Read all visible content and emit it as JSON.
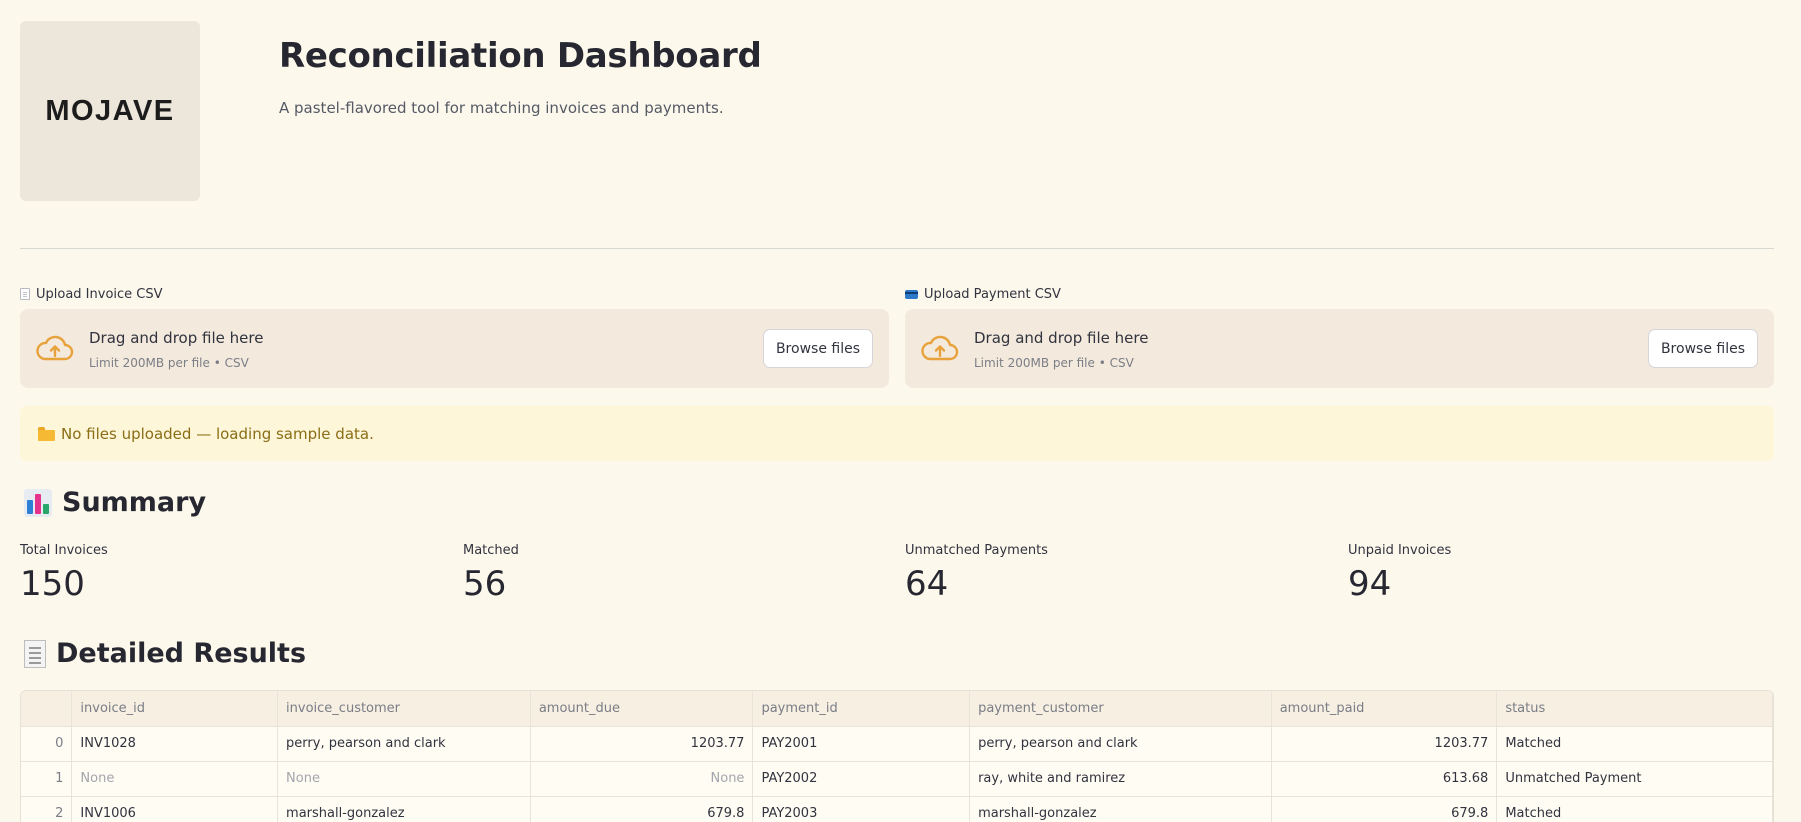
{
  "header": {
    "logo_text": "MOJAVE",
    "title": "Reconciliation Dashboard",
    "subtitle": "A pastel-flavored tool for matching invoices and payments."
  },
  "uploaders": [
    {
      "label": "Upload Invoice CSV",
      "icon": "page-icon",
      "drop_text": "Drag and drop file here",
      "limit_text": "Limit 200MB per file • CSV",
      "button_label": "Browse files"
    },
    {
      "label": "Upload Payment CSV",
      "icon": "credit-card-icon",
      "drop_text": "Drag and drop file here",
      "limit_text": "Limit 200MB per file • CSV",
      "button_label": "Browse files"
    }
  ],
  "alert": {
    "icon": "folder-icon",
    "text": "No files uploaded — loading sample data."
  },
  "summary": {
    "heading": "Summary",
    "icon": "bar-chart-icon",
    "metrics": [
      {
        "label": "Total Invoices",
        "value": "150"
      },
      {
        "label": "Matched",
        "value": "56"
      },
      {
        "label": "Unmatched Payments",
        "value": "64"
      },
      {
        "label": "Unpaid Invoices",
        "value": "94"
      }
    ]
  },
  "details": {
    "heading": "Detailed Results",
    "icon": "receipt-icon",
    "columns": [
      "",
      "invoice_id",
      "invoice_customer",
      "amount_due",
      "payment_id",
      "payment_customer",
      "amount_paid",
      "status"
    ],
    "rows": [
      [
        "0",
        "INV1028",
        "perry, pearson and clark",
        "1203.77",
        "PAY2001",
        "perry, pearson and clark",
        "1203.77",
        "Matched"
      ],
      [
        "1",
        "None",
        "None",
        "None",
        "PAY2002",
        "ray, white and ramirez",
        "613.68",
        "Unmatched Payment"
      ],
      [
        "2",
        "INV1006",
        "marshall-gonzalez",
        "679.8",
        "PAY2003",
        "marshall-gonzalez",
        "679.8",
        "Matched"
      ]
    ]
  },
  "colors": {
    "background": "#fdf8ec",
    "dropzone": "#f3e9dc",
    "alert_bg": "#fdf6d8",
    "alert_text": "#8a6d16",
    "cloud_icon": "#e8a23c"
  }
}
